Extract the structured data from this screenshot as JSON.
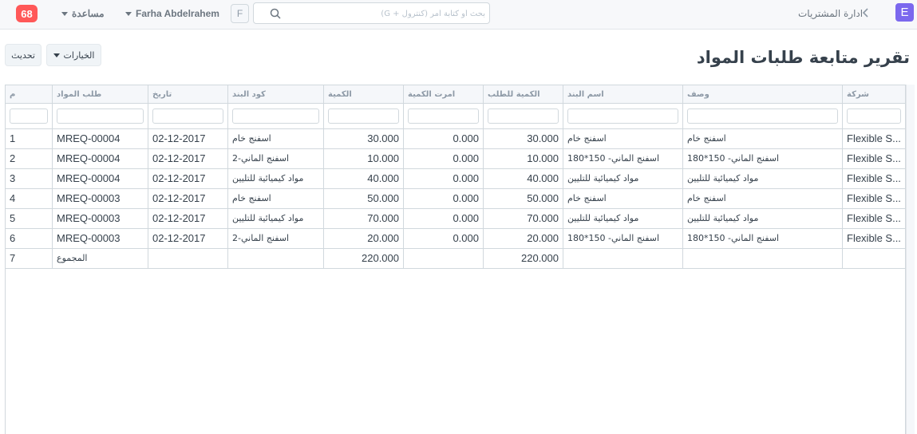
{
  "navbar": {
    "notifications_count": "68",
    "help_label": "مساعدة",
    "user_name": "Farha Abdelrahem",
    "user_initial": "F",
    "search_placeholder": "بحث أو كتابة أمر (كنترول + G)",
    "breadcrumb": "ادارة المشتريات",
    "app_logo": "E"
  },
  "page": {
    "title": "تقرير متابعة طلبات المواد",
    "refresh_label": "تحديث",
    "options_label": "الخيارات"
  },
  "table": {
    "columns": [
      "م",
      "طلب المواد",
      "تاريخ",
      "كود البند",
      "الكمية",
      "امرت الكمية",
      "الكمية للطلب",
      "اسم البند",
      "وصف",
      "شركة"
    ],
    "rows": [
      {
        "idx": "1",
        "mreq": "MREQ-00004",
        "date": "02-12-2017",
        "item_code": "اسفنج خام",
        "qty": "30.000",
        "ordered_qty": "0.000",
        "qty_to_order": "30.000",
        "item_name": "اسفنج خام",
        "description": "اسفنج خام",
        "company": "Flexible S..."
      },
      {
        "idx": "2",
        "mreq": "MREQ-00004",
        "date": "02-12-2017",
        "item_code": "اسفنج الماني-2",
        "qty": "10.000",
        "ordered_qty": "0.000",
        "qty_to_order": "10.000",
        "item_name": "اسفنج الماني- 150*180",
        "description": "اسفنج الماني- 150*180",
        "company": "Flexible S..."
      },
      {
        "idx": "3",
        "mreq": "MREQ-00004",
        "date": "02-12-2017",
        "item_code": "مواد كيميائية للتليين",
        "qty": "40.000",
        "ordered_qty": "0.000",
        "qty_to_order": "40.000",
        "item_name": "مواد كيميائية للتليين",
        "description": "مواد كيميائية للتليين",
        "company": "Flexible S..."
      },
      {
        "idx": "4",
        "mreq": "MREQ-00003",
        "date": "02-12-2017",
        "item_code": "اسفنج خام",
        "qty": "50.000",
        "ordered_qty": "0.000",
        "qty_to_order": "50.000",
        "item_name": "اسفنج خام",
        "description": "اسفنج خام",
        "company": "Flexible S..."
      },
      {
        "idx": "5",
        "mreq": "MREQ-00003",
        "date": "02-12-2017",
        "item_code": "مواد كيميائية للتليين",
        "qty": "70.000",
        "ordered_qty": "0.000",
        "qty_to_order": "70.000",
        "item_name": "مواد كيميائية للتليين",
        "description": "مواد كيميائية للتليين",
        "company": "Flexible S..."
      },
      {
        "idx": "6",
        "mreq": "MREQ-00003",
        "date": "02-12-2017",
        "item_code": "اسفنج الماني-2",
        "qty": "20.000",
        "ordered_qty": "0.000",
        "qty_to_order": "20.000",
        "item_name": "اسفنج الماني- 150*180",
        "description": "اسفنج الماني- 150*180",
        "company": "Flexible S..."
      }
    ],
    "total_row": {
      "idx": "7",
      "label": "المجموع",
      "qty": "220.000",
      "qty_to_order": "220.000"
    }
  },
  "colors": {
    "badge": "#ff5858",
    "logo": "#7b68ee",
    "border": "#d1d8dd",
    "header_bg": "#f5f7fa"
  },
  "icons": {
    "search": "search-icon",
    "back": "chevron-left-icon",
    "dropdown": "caret-down-icon"
  }
}
